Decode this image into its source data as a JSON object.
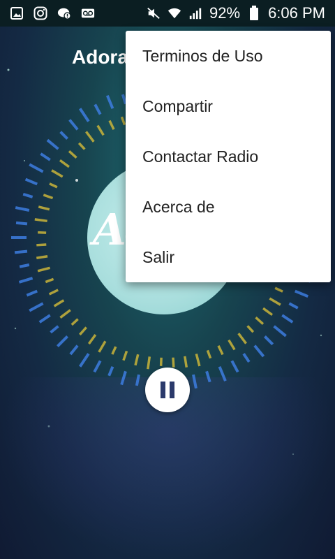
{
  "status_bar": {
    "battery": "92%",
    "time": "6:06 PM",
    "icons_left": [
      "gallery-icon",
      "instagram-icon",
      "chat-alert-icon",
      "voicemail-icon"
    ],
    "icons_right": [
      "mute-icon",
      "wifi-icon",
      "signal-icon",
      "battery-icon"
    ]
  },
  "app": {
    "title": "Adora",
    "art_text": "Ad"
  },
  "menu": {
    "items": [
      {
        "label": "Terminos de Uso"
      },
      {
        "label": "Compartir"
      },
      {
        "label": "Contactar Radio"
      },
      {
        "label": "Acerca de"
      },
      {
        "label": "Salir"
      }
    ]
  },
  "player": {
    "state": "playing",
    "button_icon": "pause-icon"
  },
  "colors": {
    "status_bar_bg": "#0b1e22",
    "ring_blue": "#3d7de0",
    "ring_yellow": "#c9b43a",
    "menu_bg": "#ffffff"
  }
}
